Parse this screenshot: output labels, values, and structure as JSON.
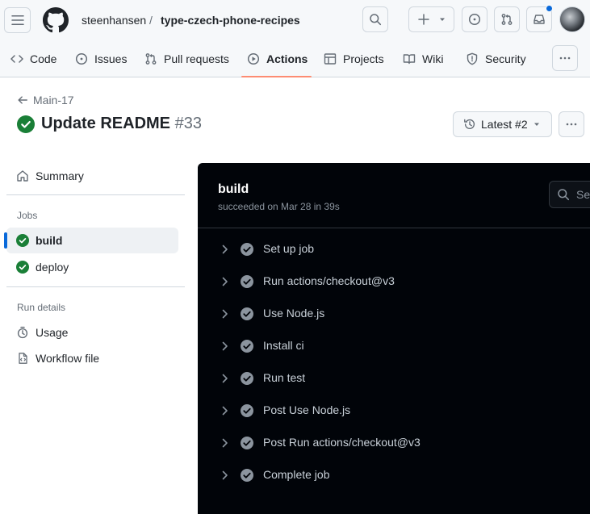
{
  "header": {
    "owner": "steenhansen",
    "separator": "/",
    "repo": "type-czech-phone-recipes"
  },
  "icons": {
    "menu": "hamburger-icon",
    "logo": "github-mark-icon",
    "search": "search-icon",
    "create": "plus-icon",
    "issues": "issue-opened-icon",
    "pulls": "git-pull-request-icon",
    "inbox": "inbox-icon",
    "success": "check-circle-fill-icon"
  },
  "colors": {
    "success": "#1a7f37",
    "accent_underline": "#fd8c73",
    "selected_marker": "#0969da",
    "log_background": "#010409"
  },
  "tabs": [
    {
      "label": "Code"
    },
    {
      "label": "Issues"
    },
    {
      "label": "Pull requests"
    },
    {
      "label": "Actions"
    },
    {
      "label": "Projects"
    },
    {
      "label": "Wiki"
    },
    {
      "label": "Security"
    }
  ],
  "run": {
    "back_label": "Main-17",
    "title": "Update README",
    "number": "#33",
    "latest_label": "Latest #2"
  },
  "sidebar": {
    "summary_label": "Summary",
    "jobs_heading": "Jobs",
    "jobs": [
      {
        "label": "build"
      },
      {
        "label": "deploy"
      }
    ],
    "run_details_heading": "Run details",
    "usage_label": "Usage",
    "workflow_label": "Workflow file"
  },
  "log": {
    "job_name": "build",
    "status": "succeeded on Mar 28 in 39s",
    "search_placeholder": "Sea",
    "steps": [
      {
        "label": "Set up job"
      },
      {
        "label": "Run actions/checkout@v3"
      },
      {
        "label": "Use Node.js"
      },
      {
        "label": "Install ci"
      },
      {
        "label": "Run test"
      },
      {
        "label": "Post Use Node.js"
      },
      {
        "label": "Post Run actions/checkout@v3"
      },
      {
        "label": "Complete job"
      }
    ]
  }
}
